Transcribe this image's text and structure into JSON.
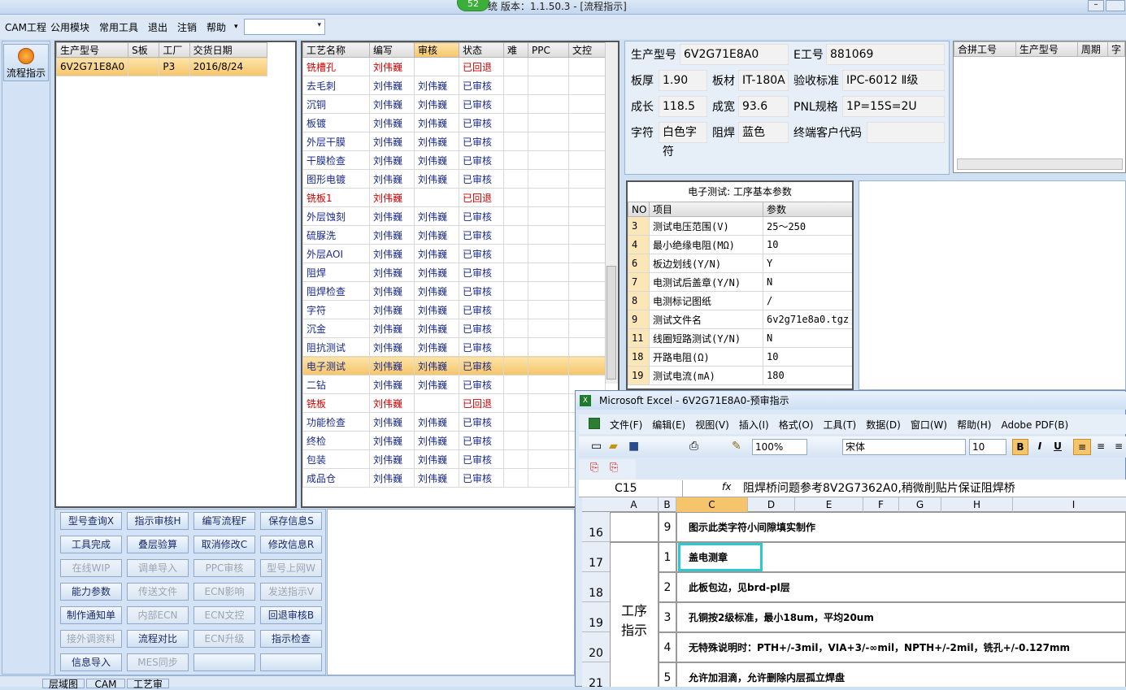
{
  "app": {
    "title": "统 版本：1.1.50.3 - [流程指示]",
    "badge": "52"
  },
  "menu": [
    "CAM工程",
    "公用模块",
    "常用工具",
    "退出",
    "注销",
    "帮助"
  ],
  "left_button": "流程指示",
  "product_table": {
    "headers": [
      "生产型号",
      "S板",
      "工厂",
      "交货日期"
    ],
    "row": [
      "6V2G71E8A0",
      "",
      "P3",
      "2016/8/24"
    ]
  },
  "process_table": {
    "headers": [
      "工艺名称",
      "编写",
      "审核",
      "状态",
      "难",
      "PPC",
      "文控"
    ],
    "rows": [
      {
        "name": "铣槽孔",
        "writer": "刘伟巍",
        "reviewer": "",
        "status": "已回退",
        "red": true
      },
      {
        "name": "去毛刺",
        "writer": "刘伟巍",
        "reviewer": "刘伟巍",
        "status": "已审核"
      },
      {
        "name": "沉铜",
        "writer": "刘伟巍",
        "reviewer": "刘伟巍",
        "status": "已审核"
      },
      {
        "name": "板镀",
        "writer": "刘伟巍",
        "reviewer": "刘伟巍",
        "status": "已审核"
      },
      {
        "name": "外层干膜",
        "writer": "刘伟巍",
        "reviewer": "刘伟巍",
        "status": "已审核"
      },
      {
        "name": "干膜检查",
        "writer": "刘伟巍",
        "reviewer": "刘伟巍",
        "status": "已审核"
      },
      {
        "name": "图形电镀",
        "writer": "刘伟巍",
        "reviewer": "刘伟巍",
        "status": "已审核"
      },
      {
        "name": "铣板1",
        "writer": "刘伟巍",
        "reviewer": "",
        "status": "已回退",
        "red": true
      },
      {
        "name": "外层蚀刻",
        "writer": "刘伟巍",
        "reviewer": "刘伟巍",
        "status": "已审核"
      },
      {
        "name": "硫脲洗",
        "writer": "刘伟巍",
        "reviewer": "刘伟巍",
        "status": "已审核"
      },
      {
        "name": "外层AOI",
        "writer": "刘伟巍",
        "reviewer": "刘伟巍",
        "status": "已审核"
      },
      {
        "name": "阻焊",
        "writer": "刘伟巍",
        "reviewer": "刘伟巍",
        "status": "已审核"
      },
      {
        "name": "阻焊检查",
        "writer": "刘伟巍",
        "reviewer": "刘伟巍",
        "status": "已审核"
      },
      {
        "name": "字符",
        "writer": "刘伟巍",
        "reviewer": "刘伟巍",
        "status": "已审核"
      },
      {
        "name": "沉金",
        "writer": "刘伟巍",
        "reviewer": "刘伟巍",
        "status": "已审核"
      },
      {
        "name": "阻抗测试",
        "writer": "刘伟巍",
        "reviewer": "刘伟巍",
        "status": "已审核"
      },
      {
        "name": "电子测试",
        "writer": "刘伟巍",
        "reviewer": "刘伟巍",
        "status": "已审核",
        "selected": true
      },
      {
        "name": "二钻",
        "writer": "刘伟巍",
        "reviewer": "刘伟巍",
        "status": "已审核"
      },
      {
        "name": "铣板",
        "writer": "刘伟巍",
        "reviewer": "",
        "status": "已回退",
        "red": true
      },
      {
        "name": "功能检查",
        "writer": "刘伟巍",
        "reviewer": "刘伟巍",
        "status": "已审核"
      },
      {
        "name": "终检",
        "writer": "刘伟巍",
        "reviewer": "刘伟巍",
        "status": "已审核"
      },
      {
        "name": "包装",
        "writer": "刘伟巍",
        "reviewer": "刘伟巍",
        "status": "已审核"
      },
      {
        "name": "成品仓",
        "writer": "刘伟巍",
        "reviewer": "刘伟巍",
        "status": "已审核"
      }
    ]
  },
  "info": {
    "model_label": "生产型号",
    "model": "6V2G71E8A0",
    "eno_label": "E工号",
    "eno": "881069",
    "thick_label": "板厚",
    "thick": "1.90",
    "mat_label": "板材",
    "mat": "IT-180A",
    "std_label": "验收标准",
    "std": "IPC-6012 Ⅱ级",
    "len_label": "成长",
    "len": "118.5",
    "wid_label": "成宽",
    "wid": "93.6",
    "pnl_label": "PNL规格",
    "pnl": "1P=15S=2U",
    "char_label": "字符",
    "char": "白色字符",
    "mask_label": "阻焊",
    "mask": "蓝色",
    "cust_label": "终端客户代码",
    "cust": ""
  },
  "combine_table": {
    "headers": [
      "合拼工号",
      "生产型号",
      "周期",
      "字"
    ]
  },
  "params": {
    "title": "电子测试: 工序基本参数",
    "headers": [
      "NO",
      "项目",
      "参数"
    ],
    "rows": [
      [
        "3",
        "测试电压范围(V)",
        "25～250"
      ],
      [
        "4",
        "最小绝缘电阻(MΩ)",
        "10"
      ],
      [
        "6",
        "板边划线(Y/N)",
        "Y"
      ],
      [
        "7",
        "电测试后盖章(Y/N)",
        "N"
      ],
      [
        "8",
        "电测标记图纸",
        "/"
      ],
      [
        "9",
        "测试文件名",
        "6v2g71e8a0.tgz"
      ],
      [
        "11",
        "线圈短路测试(Y/N)",
        "N"
      ],
      [
        "18",
        "开路电阻(Ω)",
        "10"
      ],
      [
        "19",
        "测试电流(mA)",
        "180"
      ]
    ]
  },
  "buttons": [
    [
      "型号查询X",
      "指示审核H",
      "编写流程F",
      "保存信息S"
    ],
    [
      "工具完成",
      "叠层验算",
      "取消修改C",
      "修改信息R"
    ],
    [
      "在线WIP",
      "调单导入",
      "PPC审核",
      "型号上网W"
    ],
    [
      "能力参数",
      "传送文件",
      "ECN影响",
      "发送指示V"
    ],
    [
      "制作通知单",
      "内部ECN",
      "ECN文控",
      "回退审核B"
    ],
    [
      "接外调资料",
      "流程对比",
      "ECN升级",
      "指示检查"
    ],
    [
      "信息导入",
      "MES同步",
      "",
      ""
    ]
  ],
  "disabled": [
    "在线WIP",
    "调单导入",
    "PPC审核",
    "型号上网W",
    "传送文件",
    "ECN影响",
    "发送指示V",
    "内部ECN",
    "ECN文控",
    "接外调资料",
    "ECN升级",
    "MES同步"
  ],
  "bottom_tabs": [
    "层域图",
    "CAM",
    "工艺审"
  ],
  "excel": {
    "title": "Microsoft Excel - 6V2G71E8A0-预审指示",
    "menu": [
      "文件(F)",
      "编辑(E)",
      "视图(V)",
      "插入(I)",
      "格式(O)",
      "工具(T)",
      "数据(D)",
      "窗口(W)",
      "帮助(H)",
      "Adobe PDF(B)"
    ],
    "zoom": "100%",
    "font": "宋体",
    "size": "10",
    "cellref": "C15",
    "fx": "fx",
    "formula": "阻焊桥问题参考8V2G7362A0,稍微削贴片保证阻焊桥",
    "cols": [
      "A",
      "B",
      "C",
      "D",
      "E",
      "F",
      "G",
      "H",
      "I"
    ],
    "merged_label": "工序指示",
    "rows": [
      [
        "16",
        "9",
        "图示此类字符小间隙填实制作"
      ],
      [
        "17",
        "1",
        "盖电测章"
      ],
      [
        "18",
        "2",
        "此板包边，见brd-pl层"
      ],
      [
        "19",
        "3",
        "孔铜按2级标准，最小18um，平均20um"
      ],
      [
        "20",
        "4",
        "无特殊说明时：PTH+/-3mil，VIA+3/-∞mil，NPTH+/-2mil，铣孔+/-0.127mm"
      ],
      [
        "21",
        "5",
        "允许加泪滴，允许删除内层孤立焊盘"
      ]
    ]
  }
}
